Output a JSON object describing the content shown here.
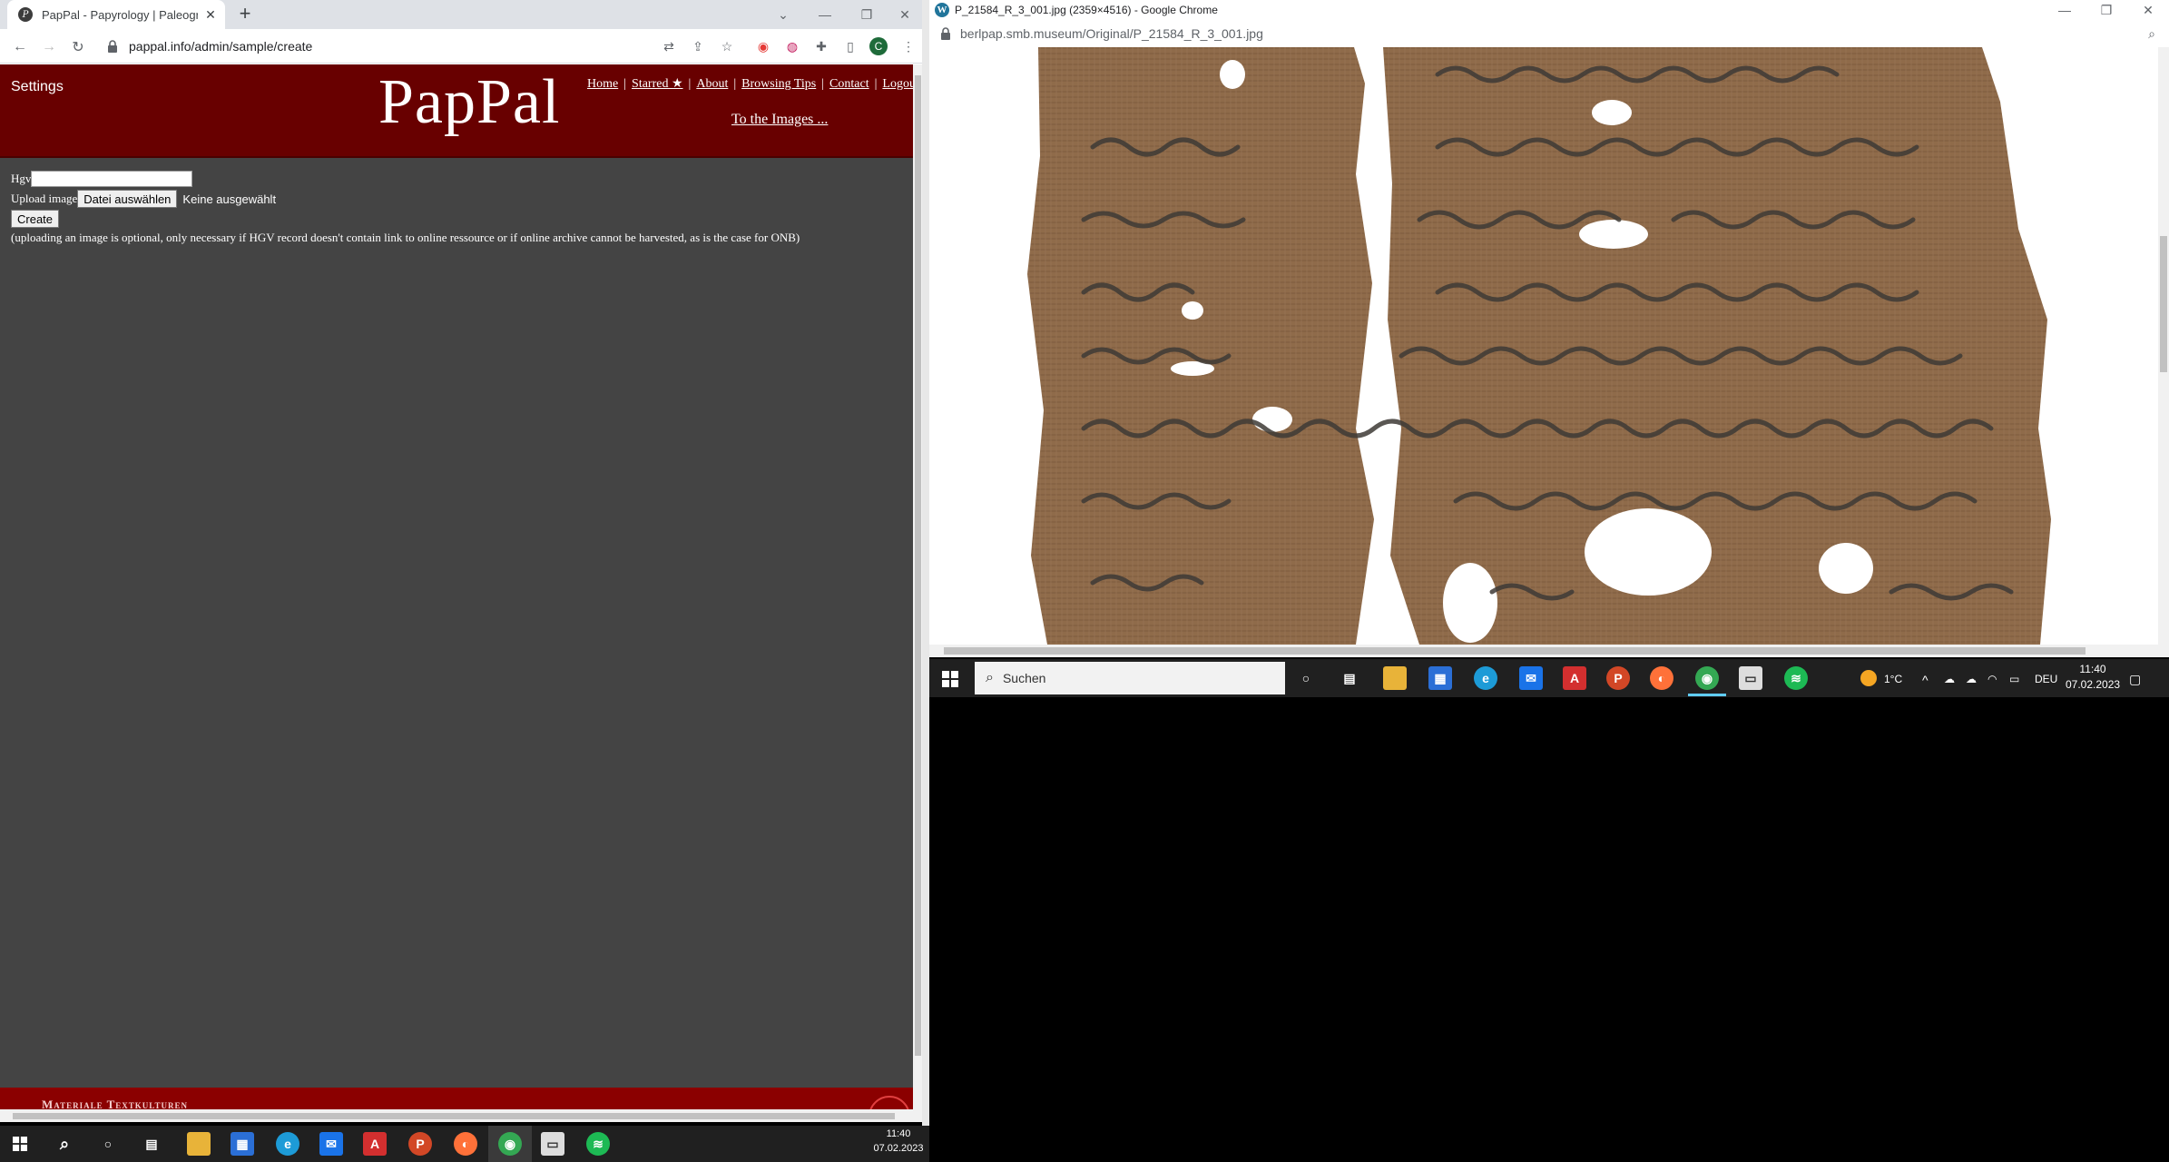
{
  "left_window": {
    "tab_title": "PapPal - Papyrology | Paleograph",
    "favicon_letter": "P",
    "url": "pappal.info/admin/sample/create",
    "profile_initial": "C"
  },
  "site": {
    "settings_label": "Settings",
    "logo": "PapPal",
    "nav": [
      {
        "label": "Home"
      },
      {
        "label": "Starred ★"
      },
      {
        "label": "About"
      },
      {
        "label": "Browsing Tips"
      },
      {
        "label": "Contact"
      },
      {
        "label": "Logout"
      }
    ],
    "nav_separator": "|",
    "to_images": "To the Images ...",
    "form": {
      "hgv_label": "Hgv",
      "hgv_value": "",
      "upload_label": "Upload image",
      "file_button": "Datei auswählen",
      "file_status": "Keine ausgewählt",
      "create_button": "Create",
      "note": "(uploading an image is optional, only necessary if HGV record doesn't contain link to online ressource or if online archive cannot be harvested, as is the case for ONB)"
    },
    "footer_text": "Materiale Textkulturen"
  },
  "right_window": {
    "title": "P_21584_R_3_001.jpg (2359×4516) - Google Chrome",
    "favicon_letter": "W",
    "url": "berlpap.smb.museum/Original/P_21584_R_3_001.jpg"
  },
  "right_taskbar": {
    "search_placeholder": "Suchen",
    "temperature": "1°C",
    "language": "DEU",
    "time": "11:40",
    "date": "07.02.2023"
  },
  "left_taskbar": {
    "time": "11:40",
    "date": "07.02.2023"
  },
  "colors": {
    "banner": "#680000",
    "page_bg": "#444444",
    "footer": "#8b0000",
    "taskbar": "#202020"
  }
}
